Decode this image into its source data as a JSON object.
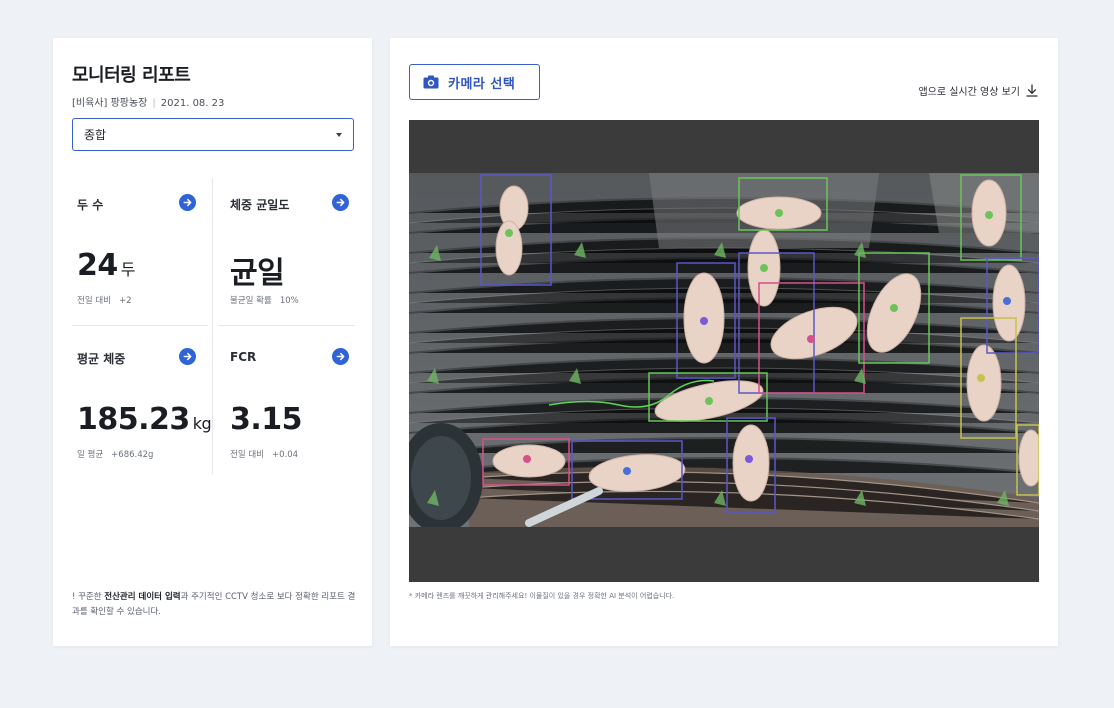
{
  "report": {
    "title": "모니터링 리포트",
    "farm": "[비육사] 팡팡농장",
    "date": "2021. 08. 23",
    "filter": {
      "selected": "종합"
    }
  },
  "metrics": [
    {
      "label": "두 수",
      "value": "24",
      "unit": "두",
      "sub_label": "전일 대비",
      "sub_delta": "+2"
    },
    {
      "label": "체중 균일도",
      "value": "균일",
      "unit": "",
      "sub_label": "불균일 확률",
      "sub_delta": "10%"
    },
    {
      "label": "평균 체중",
      "value": "185.23",
      "unit": "kg",
      "sub_label": "일 평균",
      "sub_delta": "+686.42g"
    },
    {
      "label": "FCR",
      "value": "3.15",
      "unit": "",
      "sub_label": "전일 대비",
      "sub_delta": "+0.04"
    }
  ],
  "footnote": {
    "prefix": "! 꾸준한 ",
    "bold": "전산관리 데이터 입력",
    "suffix": "과 주기적인 CCTV 청소로 보다 정확한 리포트 결과를 확인할 수 있습니다."
  },
  "camera": {
    "select_label": "카메라 선택",
    "app_link_label": "앱으로 실시간 영상 보기",
    "note": "* 카메라 렌즈를 깨끗하게 관리해주세요! 이물질이 있을 경우 정확한 AI 분석이 어렵습니다."
  },
  "icons": {
    "arrow": "arrow-right-icon",
    "camera": "camera-icon",
    "download": "download-icon",
    "dropdown": "chevron-down-icon"
  },
  "colors": {
    "accent": "#2f63d6",
    "border_accent": "#3a5fc8",
    "background": "#eef1f5"
  }
}
